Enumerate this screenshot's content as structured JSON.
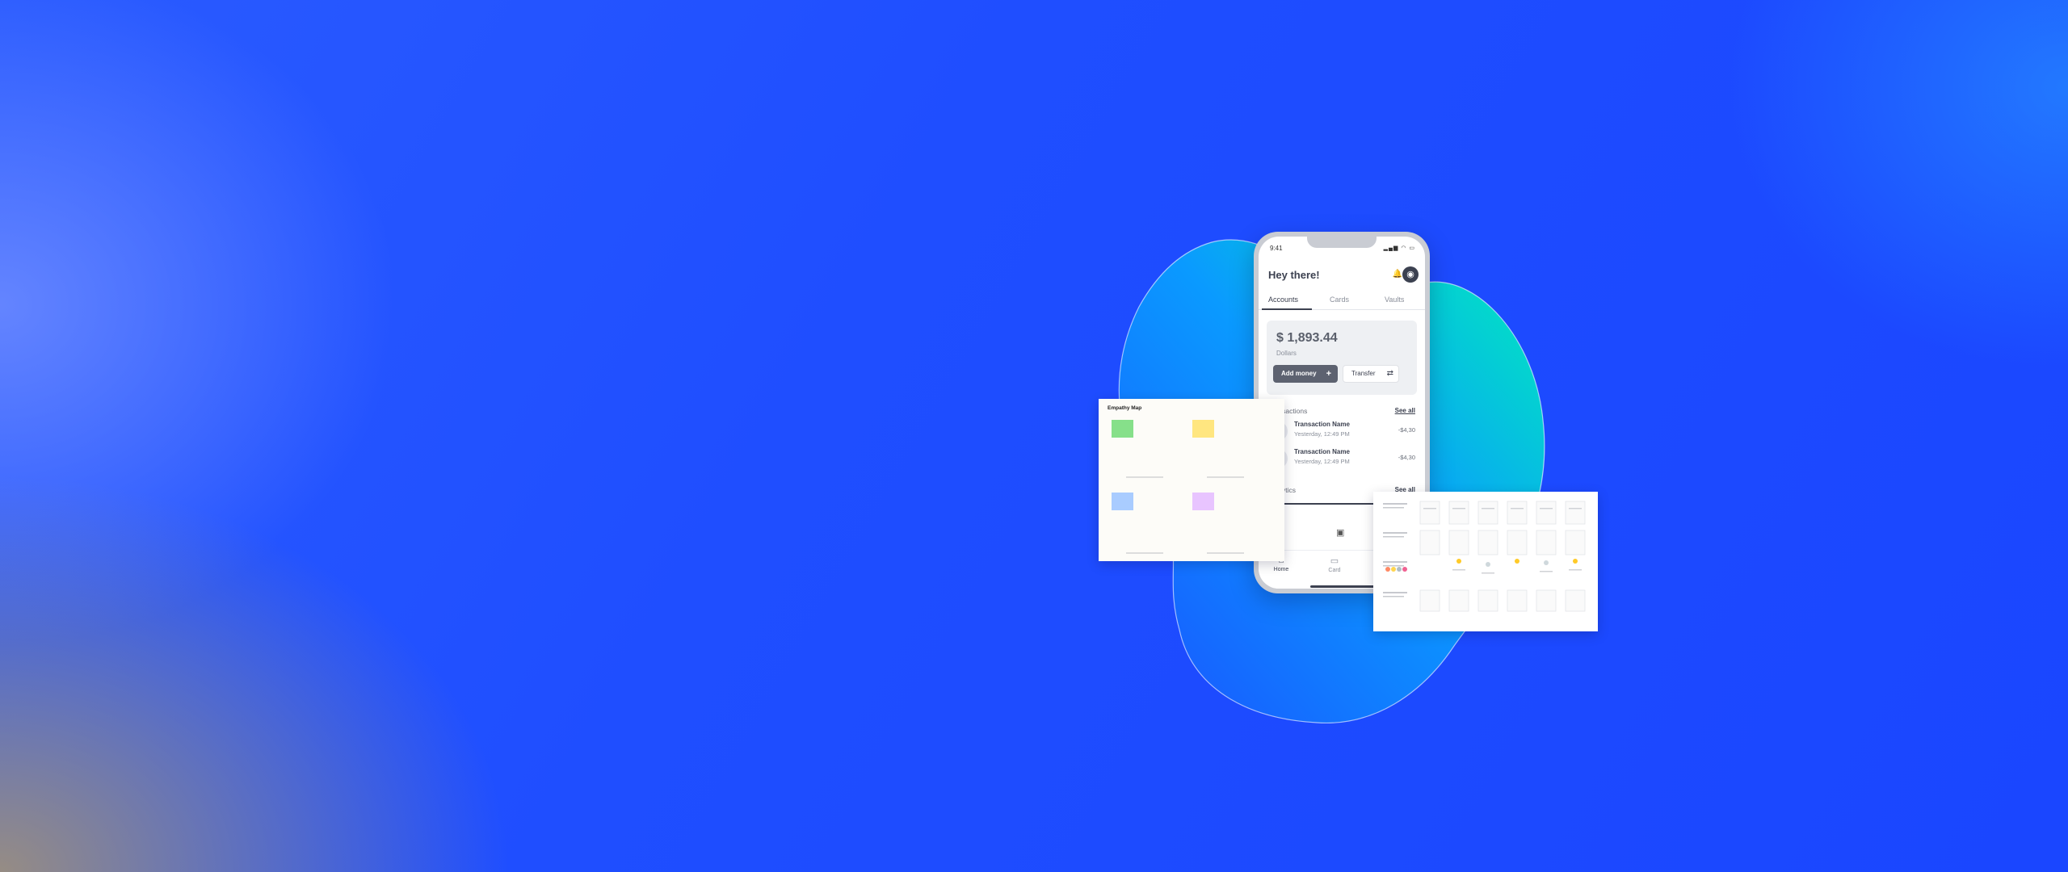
{
  "phone": {
    "status_time": "9:41",
    "status_icons": "▂▄▆ ◠ ▭",
    "greeting": "Hey there!",
    "tabs": [
      "Accounts",
      "Cards",
      "Vaults"
    ],
    "active_tab": "Accounts",
    "balance": {
      "amount": "$ 1,893.44",
      "currency": "Dollars",
      "add_money_label": "Add money",
      "transfer_label": "Transfer"
    },
    "transactions_title": "Transactions",
    "see_all_label": "See all",
    "transactions": [
      {
        "name": "Transaction Name",
        "date": "Yesterday, 12:49 PM",
        "amount": "-$4,30"
      },
      {
        "name": "Transaction Name",
        "date": "Yesterday, 12:49 PM",
        "amount": "-$4,30"
      }
    ],
    "analytics_title": "Analytics",
    "bottom_nav": [
      {
        "label": "Home",
        "icon": "home-icon"
      },
      {
        "label": "Card",
        "icon": "card-icon"
      }
    ]
  },
  "empathy_map": {
    "title": "Empathy Map",
    "sticky_colors": [
      "#86e08a",
      "#ffe680",
      "#a9ccff",
      "#e8c4ff"
    ]
  },
  "colors": {
    "background": "#1f4eff",
    "blob_start": "#00e8c0",
    "blob_end": "#1a6bff",
    "phone_frame": "#c9ccd3",
    "primary_button": "#5d6270"
  }
}
